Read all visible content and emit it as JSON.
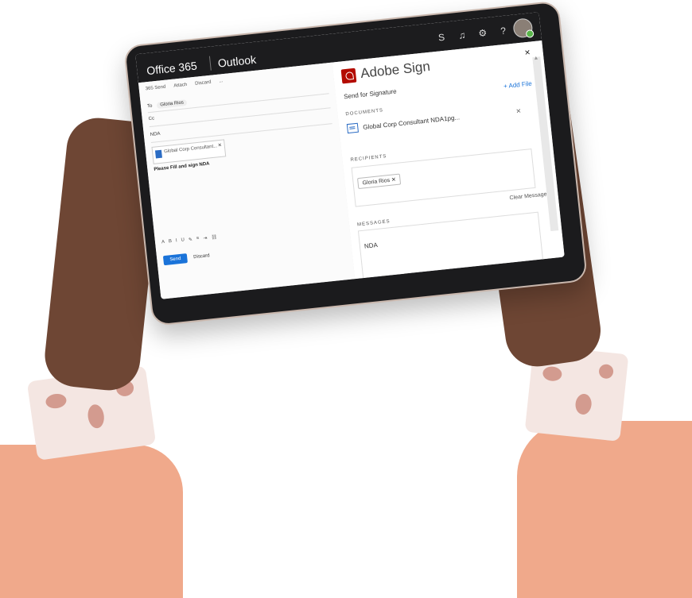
{
  "office": {
    "brand": "Office 365",
    "app": "Outlook"
  },
  "compose": {
    "commands": [
      "365 Send",
      "Attach",
      "Discard",
      "..."
    ],
    "to_label": "To",
    "to_recipient": "Gloria Rios",
    "cc_label": "Cc",
    "subject": "NDA",
    "attachment": "Global Corp Consultant...",
    "body": "Please Fill and sign NDA",
    "send_label": "Send",
    "discard_label": "Discard"
  },
  "panel": {
    "title": "Adobe Sign",
    "close": "×",
    "send_for_signature": "Send for Signature",
    "add_file": "+ Add File",
    "documents_label": "DOCUMENTS",
    "document_name": "Global Corp Consultant NDA1pg...",
    "recipients_label": "RECIPIENTS",
    "recipient_chip": "Gloria Rios ✕",
    "clear_message": "Clear Message",
    "messages_label": "MESSAGES",
    "message_value": "NDA"
  },
  "top_icons": [
    "skype-icon",
    "bell-icon",
    "gear-icon",
    "help-icon"
  ],
  "top_icon_glyphs": [
    "S",
    "♫",
    "⚙",
    "?"
  ]
}
